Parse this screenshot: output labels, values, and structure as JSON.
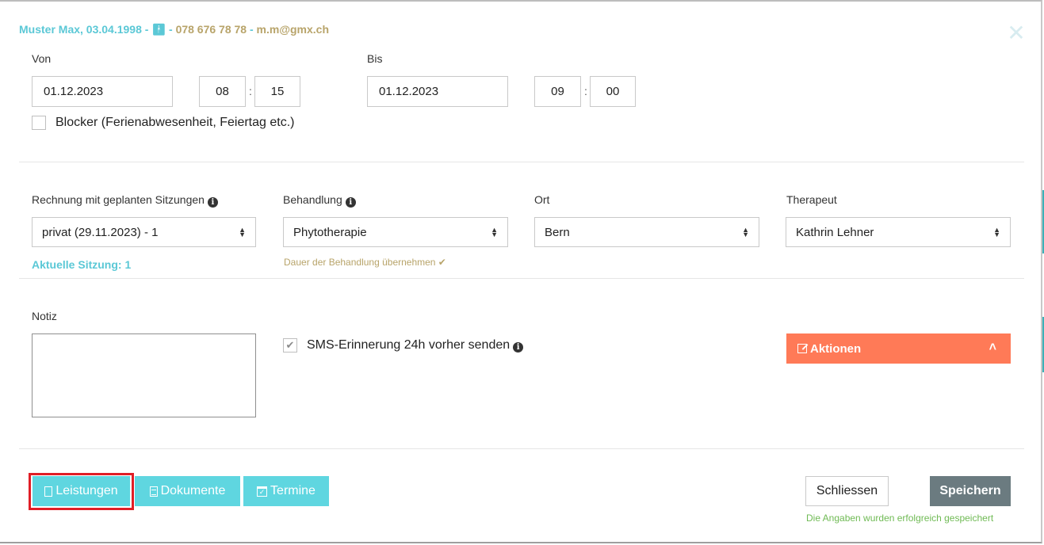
{
  "header": {
    "patient_name": "Muster Max, 03.04.1998",
    "separator": "-",
    "gender_icon": "person-icon",
    "phone": "078 676 78 78",
    "email": "m.m@gmx.ch",
    "close_glyph": "✕"
  },
  "time": {
    "from_label": "Von",
    "from_date": "01.12.2023",
    "from_hour": "08",
    "from_minute": "15",
    "to_label": "Bis",
    "to_date": "01.12.2023",
    "to_hour": "09",
    "to_minute": "00",
    "colon": ":",
    "blocker_label": "Blocker (Ferienabwesenheit, Feiertag etc.)"
  },
  "fields": {
    "invoice_label": "Rechnung mit geplanten Sitzungen",
    "invoice_value": "privat (29.11.2023) - 1",
    "current_session": "Aktuelle Sitzung: 1",
    "treatment_label": "Behandlung",
    "treatment_value": "Phytotherapie",
    "treatment_duration": "Dauer der Behandlung übernehmen ✔",
    "location_label": "Ort",
    "location_value": "Bern",
    "therapist_label": "Therapeut",
    "therapist_value": "Kathrin Lehner"
  },
  "notes": {
    "label": "Notiz",
    "value": "",
    "sms_label": "SMS-Erinnerung 24h vorher senden",
    "sms_checked": true,
    "actions_label": "Aktionen",
    "actions_chevron": "˄"
  },
  "footer": {
    "services_label": "Leistungen",
    "documents_label": "Dokumente",
    "appointments_label": "Termine",
    "close_label": "Schliessen",
    "save_label": "Speichern",
    "status_message": "Die Angaben wurden erfolgreich gespeichert"
  },
  "colors": {
    "teal": "#5fd6e0",
    "orange": "#ff7a57",
    "gold": "#b8a46a",
    "dark": "#6b7b80",
    "success": "#6fba54",
    "highlight": "#e01e26"
  }
}
